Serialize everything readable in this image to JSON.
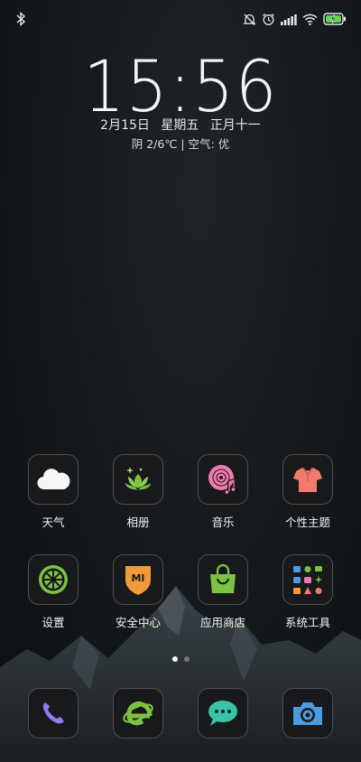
{
  "lockscreen": {
    "time": "15:56",
    "date": "2月15日",
    "weekday": "星期五",
    "lunar": "正月十一",
    "weather": "阴 2/6℃ | 空气: 优"
  },
  "status_bar": {
    "icons": [
      "bluetooth-icon",
      "silent-bell-icon",
      "alarm-icon",
      "signal-icon",
      "wifi-icon",
      "battery-charging-icon"
    ]
  },
  "apps": {
    "row1": [
      {
        "label": "天气",
        "icon": "weather-cloud-icon"
      },
      {
        "label": "相册",
        "icon": "gallery-lotus-icon"
      },
      {
        "label": "音乐",
        "icon": "music-disc-icon"
      },
      {
        "label": "个性主题",
        "icon": "themes-shirt-icon"
      }
    ],
    "row2": [
      {
        "label": "设置",
        "icon": "settings-gear-icon"
      },
      {
        "label": "安全中心",
        "icon": "security-shield-icon"
      },
      {
        "label": "应用商店",
        "icon": "app-store-bag-icon"
      },
      {
        "label": "系统工具",
        "icon": "system-tools-folder-icon"
      }
    ]
  },
  "dock": {
    "apps": [
      "phone-icon",
      "browser-icon",
      "messages-icon",
      "camera-icon"
    ]
  },
  "page_indicator": {
    "pages": 2,
    "current": 1
  },
  "shield_text": "MI",
  "colors": {
    "tile_bg": "#17191b",
    "tile_border": "#4a4e52",
    "green": "#7cc242",
    "pink": "#f07ab0",
    "salmon": "#f07b6d",
    "orange": "#f39b3a",
    "teal": "#39c4a8",
    "blue": "#4a9be0"
  }
}
